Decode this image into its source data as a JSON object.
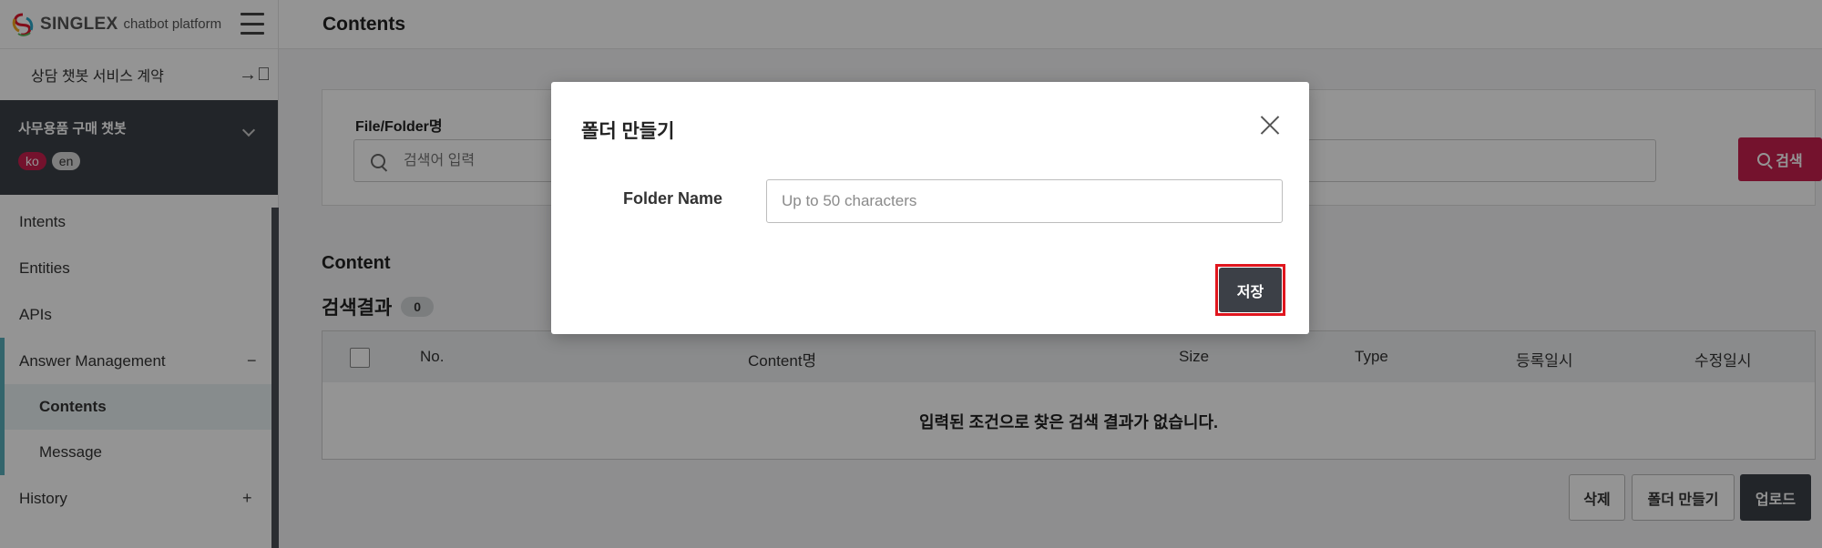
{
  "brand": {
    "name": "SINGLEX",
    "subtitle": "chatbot platform"
  },
  "sidebar": {
    "contract_label": "상담 챗봇 서비스 계약",
    "bot_name": "사무용품 구매 챗봇",
    "languages": [
      "ko",
      "en"
    ],
    "items": [
      {
        "label": "Intents"
      },
      {
        "label": "Entities"
      },
      {
        "label": "APIs"
      },
      {
        "label": "Answer Management",
        "toggle": "−"
      },
      {
        "label": "Contents"
      },
      {
        "label": "Message"
      },
      {
        "label": "History",
        "toggle": "+"
      }
    ]
  },
  "page": {
    "title": "Contents"
  },
  "search": {
    "label": "File/Folder명",
    "placeholder": "검색어 입력",
    "button_label": "검색"
  },
  "content": {
    "title": "Content",
    "result_label": "검색결과",
    "result_count": "0",
    "columns": [
      "No.",
      "Content명",
      "Size",
      "Type",
      "등록일시",
      "수정일시"
    ],
    "empty_message": "입력된 조건으로 찾은 검색 결과가 없습니다."
  },
  "actions": {
    "delete": "삭제",
    "create_folder": "폴더 만들기",
    "upload": "업로드"
  },
  "modal": {
    "title": "폴더 만들기",
    "field_label": "Folder Name",
    "field_placeholder": "Up to 50 characters",
    "save_label": "저장"
  },
  "colors": {
    "accent": "#c8204f",
    "dark": "#3c4047",
    "highlight": "#e0161e",
    "teal": "#58aebb"
  }
}
